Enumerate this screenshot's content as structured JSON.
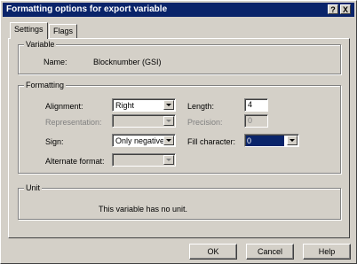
{
  "window": {
    "title": "Formatting options for export variable",
    "help_glyph": "?",
    "close_glyph": "X"
  },
  "tabs": [
    {
      "label": "Settings"
    },
    {
      "label": "Flags"
    }
  ],
  "variable": {
    "group_label": "Variable",
    "name_label": "Name:",
    "name_value": "Blocknumber (GSI)"
  },
  "formatting": {
    "group_label": "Formatting",
    "alignment": {
      "label": "Alignment:",
      "value": "Right"
    },
    "representation": {
      "label": "Representation:",
      "value": ""
    },
    "sign": {
      "label": "Sign:",
      "value": "Only negative"
    },
    "alternate_format": {
      "label": "Alternate format:",
      "value": ""
    },
    "length": {
      "label": "Length:",
      "value": "4"
    },
    "precision": {
      "label": "Precision:",
      "value": "0"
    },
    "fill_character": {
      "label": "Fill character:",
      "value": "0"
    }
  },
  "unit": {
    "group_label": "Unit",
    "message": "This variable has no unit."
  },
  "buttons": {
    "ok": "OK",
    "cancel": "Cancel",
    "help": "Help"
  },
  "colors": {
    "titlebar": "#0a246a",
    "face": "#d4d0c8",
    "selection": "#0a246a"
  }
}
